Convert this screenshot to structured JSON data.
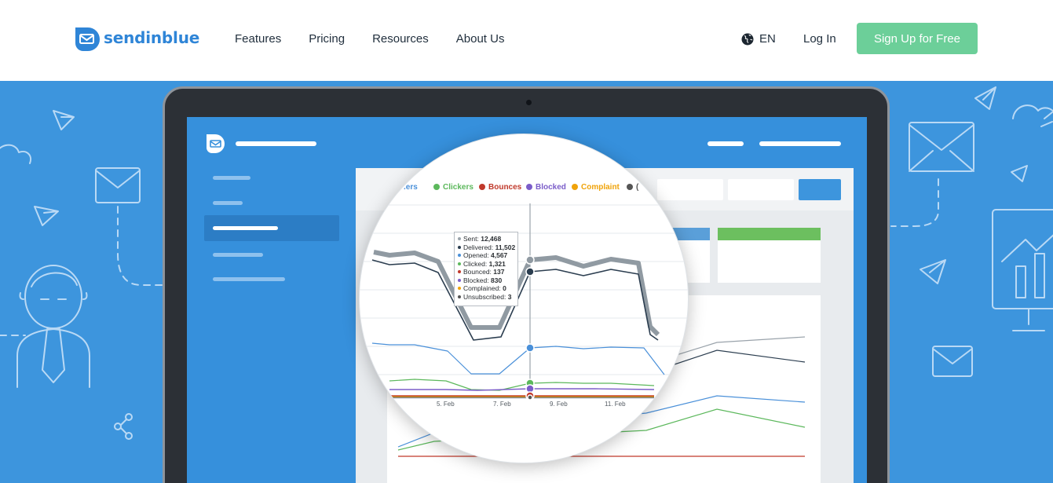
{
  "header": {
    "brand": "sendinblue",
    "nav": [
      "Features",
      "Pricing",
      "Resources",
      "About Us"
    ],
    "language": "EN",
    "login": "Log In",
    "signup": "Sign Up for Free"
  },
  "colors": {
    "brand_blue": "#2f85d7",
    "hero_bg": "#3d95dd",
    "signup_green": "#6ccf99"
  },
  "icons": [
    "sendinblue-logo-icon",
    "globe-icon",
    "paper-plane-icon",
    "envelope-icon",
    "cloud-icon",
    "share-icon",
    "person-icon",
    "monitor-icon"
  ],
  "dashboard": {
    "legend": [
      {
        "label": ".ers",
        "color": "#4a90d9"
      },
      {
        "label": "Clickers",
        "color": "#5cb85c"
      },
      {
        "label": "Bounces",
        "color": "#c0392b"
      },
      {
        "label": "Blocked",
        "color": "#7b5dc9"
      },
      {
        "label": "Complaint",
        "color": "#f0a30a"
      },
      {
        "label": "(",
        "color": "#555555"
      }
    ],
    "tooltip": [
      {
        "label": "Sent:",
        "value": "12,468",
        "color": "#9aa3ab"
      },
      {
        "label": "Delivered:",
        "value": "11,502",
        "color": "#2c3e50"
      },
      {
        "label": "Opened:",
        "value": "4,567",
        "color": "#4a90d9"
      },
      {
        "label": "Clicked:",
        "value": "1,321",
        "color": "#5cb85c"
      },
      {
        "label": "Bounced:",
        "value": "137",
        "color": "#c0392b"
      },
      {
        "label": "Blocked:",
        "value": "830",
        "color": "#7b5dc9"
      },
      {
        "label": "Complained:",
        "value": "0",
        "color": "#f0a30a"
      },
      {
        "label": "Unsubscribed:",
        "value": "3",
        "color": "#555555"
      }
    ],
    "x_ticks": [
      "5. Feb",
      "7. Feb",
      "9. Feb",
      "11. Feb"
    ]
  }
}
